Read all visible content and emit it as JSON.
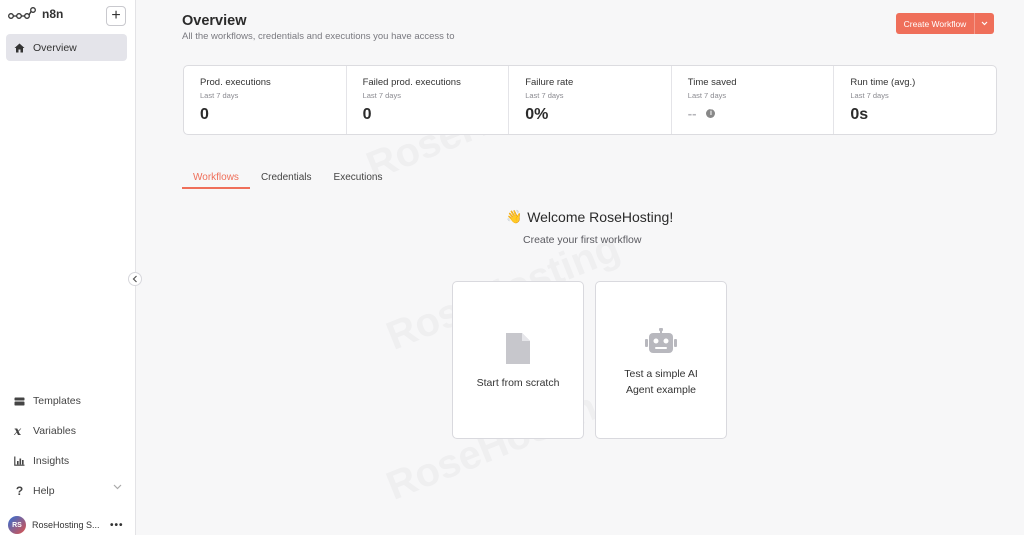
{
  "app": {
    "name": "n8n"
  },
  "sidebar": {
    "overview_label": "Overview",
    "bottom_items": [
      {
        "label": "Templates",
        "icon": "templates-icon"
      },
      {
        "label": "Variables",
        "icon": "variables-icon"
      },
      {
        "label": "Insights",
        "icon": "insights-icon"
      },
      {
        "label": "Help",
        "icon": "help-icon"
      }
    ],
    "user": {
      "initials": "RS",
      "name": "RoseHosting S..."
    }
  },
  "header": {
    "title": "Overview",
    "subtitle": "All the workflows, credentials and executions you have access to",
    "create_label": "Create Workflow"
  },
  "stats": [
    {
      "label": "Prod. executions",
      "period": "Last 7 days",
      "value": "0"
    },
    {
      "label": "Failed prod. executions",
      "period": "Last 7 days",
      "value": "0"
    },
    {
      "label": "Failure rate",
      "period": "Last 7 days",
      "value": "0%"
    },
    {
      "label": "Time saved",
      "period": "Last 7 days",
      "value": "--"
    },
    {
      "label": "Run time (avg.)",
      "period": "Last 7 days",
      "value": "0s"
    }
  ],
  "tabs": [
    "Workflows",
    "Credentials",
    "Executions"
  ],
  "welcome": {
    "emoji": "👋",
    "title": "Welcome RoseHosting!",
    "subtitle": "Create your first workflow"
  },
  "cards": [
    {
      "label": "Start from scratch"
    },
    {
      "label": "Test a simple AI Agent example"
    }
  ],
  "watermark": "RoseHosting",
  "colors": {
    "accent": "#ef6f5a",
    "active_nav": "#e4e4ea"
  }
}
